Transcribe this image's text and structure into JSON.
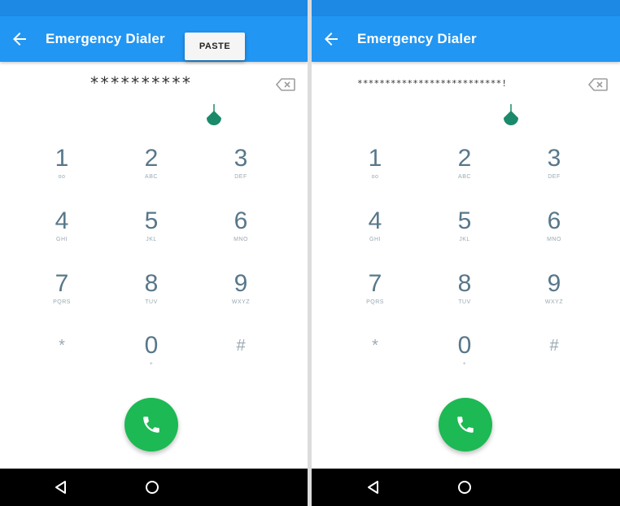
{
  "screens": [
    {
      "title": "Emergency Dialer",
      "paste_label": "PASTE",
      "digits": "**********",
      "keys": [
        {
          "digit": "1",
          "letters": "oo"
        },
        {
          "digit": "2",
          "letters": "ABC"
        },
        {
          "digit": "3",
          "letters": "DEF"
        },
        {
          "digit": "4",
          "letters": "GHI"
        },
        {
          "digit": "5",
          "letters": "JKL"
        },
        {
          "digit": "6",
          "letters": "MNO"
        },
        {
          "digit": "7",
          "letters": "PQRS"
        },
        {
          "digit": "8",
          "letters": "TUV"
        },
        {
          "digit": "9",
          "letters": "WXYZ"
        },
        {
          "digit": "*",
          "letters": ""
        },
        {
          "digit": "0",
          "letters": "+"
        },
        {
          "digit": "#",
          "letters": ""
        }
      ]
    },
    {
      "title": "Emergency Dialer",
      "digits": "**************************!",
      "keys": [
        {
          "digit": "1",
          "letters": "oo"
        },
        {
          "digit": "2",
          "letters": "ABC"
        },
        {
          "digit": "3",
          "letters": "DEF"
        },
        {
          "digit": "4",
          "letters": "GHI"
        },
        {
          "digit": "5",
          "letters": "JKL"
        },
        {
          "digit": "6",
          "letters": "MNO"
        },
        {
          "digit": "7",
          "letters": "PQRS"
        },
        {
          "digit": "8",
          "letters": "TUV"
        },
        {
          "digit": "9",
          "letters": "WXYZ"
        },
        {
          "digit": "*",
          "letters": ""
        },
        {
          "digit": "0",
          "letters": "+"
        },
        {
          "digit": "#",
          "letters": ""
        }
      ]
    }
  ],
  "icons": {
    "back": "back-arrow-icon",
    "backspace": "backspace-icon",
    "call": "phone-icon",
    "nav_back": "nav-back-icon",
    "nav_home": "nav-home-icon"
  },
  "colors": {
    "appbar": "#2196f3",
    "statusbar": "#1e88e5",
    "call_button": "#1db954",
    "caret_handle": "#1b8a6b",
    "key_digit": "#58778a",
    "navbar": "#000000"
  }
}
